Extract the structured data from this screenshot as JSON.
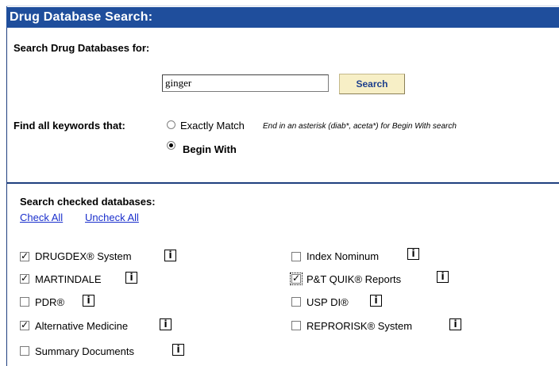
{
  "header": {
    "title": "Drug Database Search:"
  },
  "search": {
    "label": "Search Drug Databases for:",
    "value": "ginger",
    "button_label": "Search"
  },
  "keywords": {
    "label": "Find all keywords that:",
    "options": [
      {
        "label": "Exactly Match",
        "checked": false
      },
      {
        "label": "Begin With",
        "checked": true
      }
    ],
    "hint": "End in an asterisk (diab*, aceta*) for Begin With search"
  },
  "databases": {
    "label": "Search checked databases:",
    "check_all": "Check All",
    "uncheck_all": "Uncheck All",
    "info_glyph": "i",
    "left": [
      {
        "label": "DRUGDEX® System",
        "checked": true
      },
      {
        "label": "MARTINDALE",
        "checked": true
      },
      {
        "label": "PDR®",
        "checked": false
      },
      {
        "label": "Alternative Medicine",
        "checked": true
      },
      {
        "label": "Summary Documents",
        "checked": false
      }
    ],
    "right": [
      {
        "label": "Index Nominum",
        "checked": false
      },
      {
        "label": "P&T QUIK® Reports",
        "checked": true
      },
      {
        "label": "USP DI®",
        "checked": false
      },
      {
        "label": "REPRORISK® System",
        "checked": false
      }
    ]
  }
}
